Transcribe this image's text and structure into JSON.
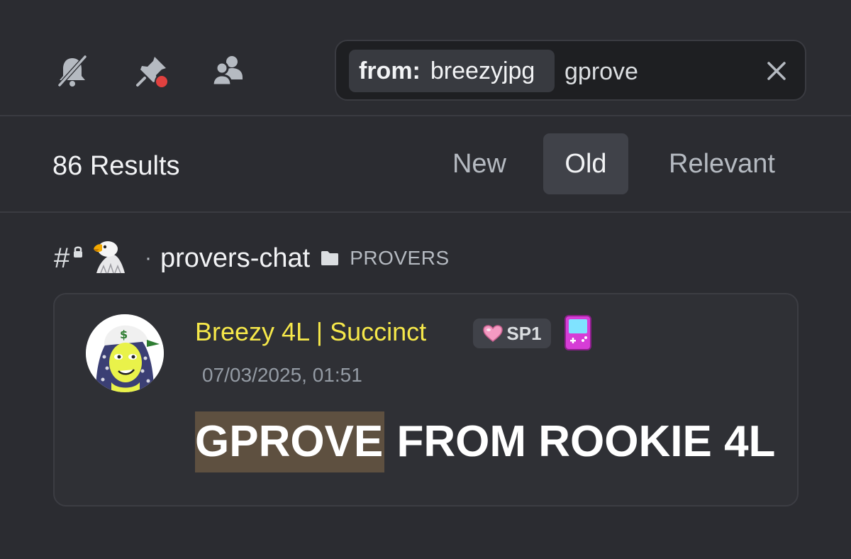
{
  "toolbar": {
    "icons": [
      "bell-slash-icon",
      "pin-icon",
      "members-icon"
    ]
  },
  "search": {
    "filter_key": "from:",
    "filter_value": "breezyjpg",
    "query": "gprove",
    "clear_icon": "close-icon"
  },
  "results": {
    "count_label": "86 Results",
    "sort_tabs": [
      {
        "label": "New",
        "active": false
      },
      {
        "label": "Old",
        "active": true
      },
      {
        "label": "Relevant",
        "active": false
      }
    ]
  },
  "channel": {
    "hash": "#",
    "emoji": "🦅",
    "separator": "·",
    "name": "provers-chat",
    "category": "PROVERS"
  },
  "message": {
    "author": "Breezy 4L | Succinct",
    "badge_label": "SP1",
    "timestamp": "07/03/2025, 01:51",
    "content_highlight": "GPROVE",
    "content_rest": " FROM ROOKIE 4L"
  },
  "colors": {
    "background": "#2b2c31",
    "card": "#2f3035",
    "author": "#f6e84a",
    "highlight": "#5e5040",
    "notification_dot": "#e0413f"
  }
}
